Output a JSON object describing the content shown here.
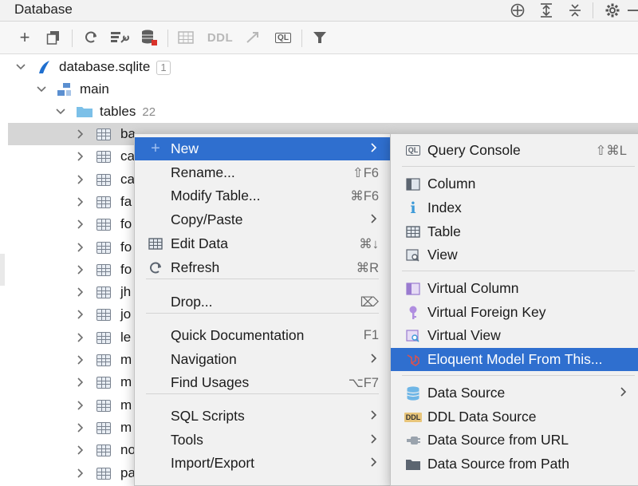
{
  "window": {
    "title": "Database"
  },
  "title_icons": [
    "crosshair-icon",
    "expand-all-icon",
    "collapse-all-icon",
    "gear-icon",
    "minimize-icon"
  ],
  "toolbar": {
    "add_icon": "+",
    "ddl_label": "DDL",
    "ql_label": "QL"
  },
  "tree": {
    "db": {
      "label": "database.sqlite",
      "badge": "1"
    },
    "schema": {
      "label": "main"
    },
    "tables": {
      "label": "tables",
      "count": "22"
    },
    "rows": [
      {
        "label": "ba",
        "selected": true
      },
      {
        "label": "ca"
      },
      {
        "label": "ca"
      },
      {
        "label": "fa"
      },
      {
        "label": "fo"
      },
      {
        "label": "fo"
      },
      {
        "label": "fo"
      },
      {
        "label": "jh"
      },
      {
        "label": "jo"
      },
      {
        "label": "le"
      },
      {
        "label": "m"
      },
      {
        "label": "m"
      },
      {
        "label": "m"
      },
      {
        "label": "m"
      },
      {
        "label": "no"
      },
      {
        "label": "pa"
      }
    ]
  },
  "context_menu": {
    "items": [
      {
        "label": "New",
        "icon": "+",
        "submenu": true,
        "highlighted": true
      },
      {
        "label": "Rename...",
        "shortcut": "⇧F6"
      },
      {
        "label": "Modify Table...",
        "shortcut": "⌘F6"
      },
      {
        "label": "Copy/Paste",
        "submenu": true
      },
      {
        "label": "Edit Data",
        "shortcut": "⌘↓",
        "icon": "table-grid-icon"
      },
      {
        "label": "Refresh",
        "shortcut": "⌘R",
        "icon": "refresh-icon"
      },
      {
        "label": "Drop...",
        "shortcut": "⌦"
      },
      {
        "label": "Quick Documentation",
        "shortcut": "F1"
      },
      {
        "label": "Navigation",
        "submenu": true
      },
      {
        "label": "Find Usages",
        "shortcut": "⌥F7"
      },
      {
        "label": "SQL Scripts",
        "submenu": true
      },
      {
        "label": "Tools",
        "submenu": true
      },
      {
        "label": "Import/Export",
        "submenu": true
      }
    ]
  },
  "new_submenu": {
    "items": [
      {
        "label": "Query Console",
        "shortcut": "⇧⌘L",
        "icon": "query-console-icon"
      },
      {
        "label": "Column",
        "icon": "column-icon"
      },
      {
        "label": "Index",
        "icon": "info-index-icon"
      },
      {
        "label": "Table",
        "icon": "table-grid-icon"
      },
      {
        "label": "View",
        "icon": "view-icon"
      },
      {
        "label": "Virtual Column",
        "icon": "virtual-column-icon"
      },
      {
        "label": "Virtual Foreign Key",
        "icon": "key-icon"
      },
      {
        "label": "Virtual View",
        "icon": "virtual-view-icon"
      },
      {
        "label": "Eloquent Model From This...",
        "icon": "laravel-icon",
        "highlighted": true
      },
      {
        "label": "Data Source",
        "icon": "database-icon",
        "submenu": true
      },
      {
        "label": "DDL Data Source",
        "icon": "ddl-icon"
      },
      {
        "label": "Data Source from URL",
        "icon": "url-plug-icon"
      },
      {
        "label": "Data Source from Path",
        "icon": "folder-icon"
      }
    ]
  },
  "colors": {
    "highlight": "#2f6fcf",
    "menu_bg": "#f1f1f1",
    "selected_row": "#d6d6d6",
    "db_icon": "#1f6fcf",
    "folder": "#7cc0e8"
  }
}
